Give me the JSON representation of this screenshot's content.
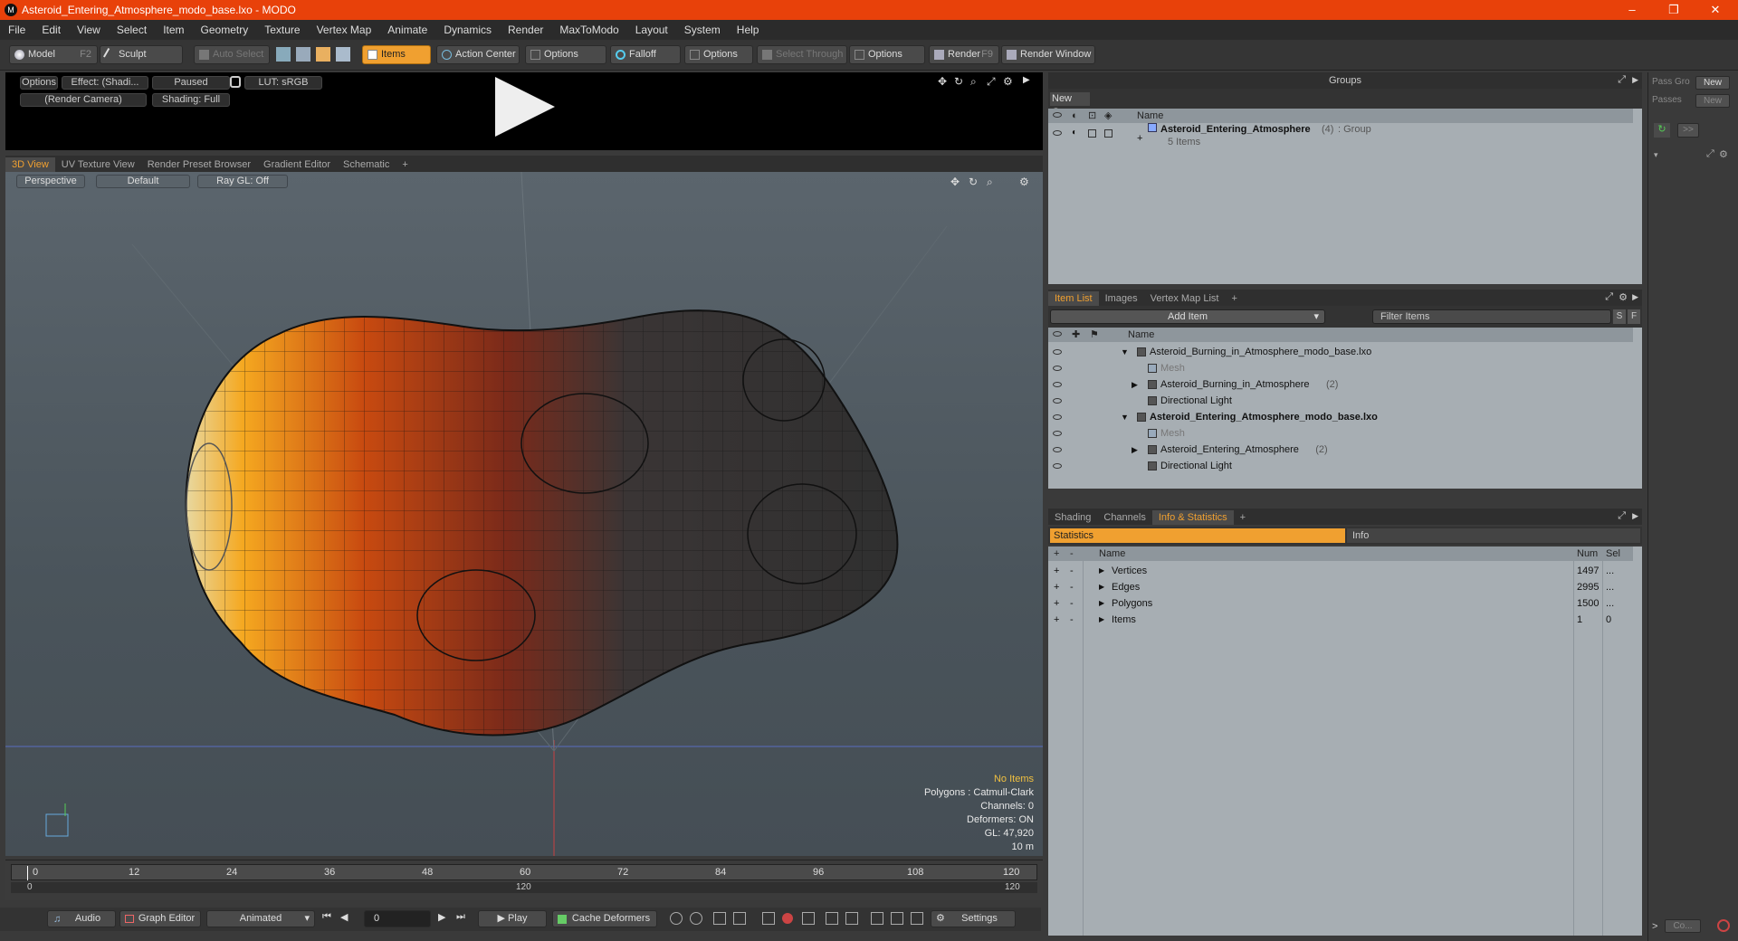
{
  "window": {
    "title": "Asteroid_Entering_Atmosphere_modo_base.lxo - MODO",
    "logo": "M",
    "minimize": "–",
    "maximize": "❐",
    "close": "✕"
  },
  "menu": [
    "File",
    "Edit",
    "View",
    "Select",
    "Item",
    "Geometry",
    "Texture",
    "Vertex Map",
    "Animate",
    "Dynamics",
    "Render",
    "MaxToModo",
    "Layout",
    "System",
    "Help"
  ],
  "toolbar": {
    "model": "Model",
    "model_key": "F2",
    "sculpt": "Sculpt",
    "auto_select": "Auto Select",
    "items": "Items",
    "action_center": "Action Center",
    "options1": "Options",
    "falloff": "Falloff",
    "options2": "Options",
    "select_through": "Select Through",
    "options3": "Options",
    "render": "Render",
    "render_key": "F9",
    "render_window": "Render Window"
  },
  "preview": {
    "options": "Options",
    "effect": "Effect: (Shadi...",
    "paused": "Paused",
    "lut": "LUT: sRGB",
    "camera": "(Render Camera)",
    "shading": "Shading: Full"
  },
  "view_tabs": [
    "3D View",
    "UV Texture View",
    "Render Preset Browser",
    "Gradient Editor",
    "Schematic",
    "+"
  ],
  "viewport": {
    "perspective": "Perspective",
    "default": "Default",
    "raygl": "Ray GL: Off",
    "overlay": {
      "no_items": "No Items",
      "polygons": "Polygons : Catmull-Clark",
      "channels": "Channels: 0",
      "deformers": "Deformers: ON",
      "gl": "GL: 47,920",
      "scale": "10 m"
    }
  },
  "timeline": {
    "ticks": [
      "0",
      "12",
      "24",
      "36",
      "48",
      "60",
      "72",
      "84",
      "96",
      "108",
      "120"
    ],
    "range_start": "0",
    "range_mid": "120",
    "range_end": "120"
  },
  "bottombar": {
    "audio": "Audio",
    "graph_editor": "Graph Editor",
    "animated": "Animated",
    "frame": "0",
    "play": "Play",
    "cache": "Cache Deformers",
    "settings": "Settings"
  },
  "groups": {
    "title": "Groups",
    "new_group": "New Group",
    "col_name": "Name",
    "item_name": "Asteroid_Entering_Atmosphere",
    "item_count": "(4)",
    "item_type": ": Group",
    "item_sub": "5 Items"
  },
  "side": {
    "pass_groups": "Pass Gro",
    "new1": "New",
    "passes": "Passes",
    "new2": "New",
    "forward": ">>",
    "compact": "Co...",
    "expand": ">"
  },
  "itemlist": {
    "tabs": [
      "Item List",
      "Images",
      "Vertex Map List",
      "+"
    ],
    "add_item": "Add Item",
    "filter": "Filter Items",
    "s": "S",
    "f": "F",
    "col_name": "Name",
    "rows": [
      {
        "label": "Asteroid_Burning_in_Atmosphere_modo_base.lxo",
        "indent": 0,
        "style": "scene"
      },
      {
        "label": "Mesh",
        "indent": 2,
        "style": "dim"
      },
      {
        "label": "Asteroid_Burning_in_Atmosphere",
        "count": "(2)",
        "indent": 1,
        "style": "normal"
      },
      {
        "label": "Directional Light",
        "indent": 1,
        "style": "normal"
      },
      {
        "label": "Asteroid_Entering_Atmosphere_modo_base.lxo",
        "indent": 0,
        "style": "scene-bold"
      },
      {
        "label": "Mesh",
        "indent": 2,
        "style": "dim"
      },
      {
        "label": "Asteroid_Entering_Atmosphere",
        "count": "(2)",
        "indent": 1,
        "style": "normal"
      },
      {
        "label": "Directional Light",
        "indent": 1,
        "style": "normal"
      }
    ]
  },
  "stats": {
    "tabs": [
      "Shading",
      "Channels",
      "Info & Statistics",
      "+"
    ],
    "sub_tabs": [
      "Statistics",
      "Info"
    ],
    "cols": {
      "plus": "+",
      "minus": "-",
      "name": "Name",
      "num": "Num",
      "sel": "Sel"
    },
    "rows": [
      {
        "name": "Vertices",
        "num": "1497",
        "sel": "..."
      },
      {
        "name": "Edges",
        "num": "2995",
        "sel": "..."
      },
      {
        "name": "Polygons",
        "num": "1500",
        "sel": "..."
      },
      {
        "name": "Items",
        "num": "1",
        "sel": "0"
      }
    ]
  },
  "colors": {
    "accent": "#f0a030",
    "title_bar": "#e8410a"
  }
}
